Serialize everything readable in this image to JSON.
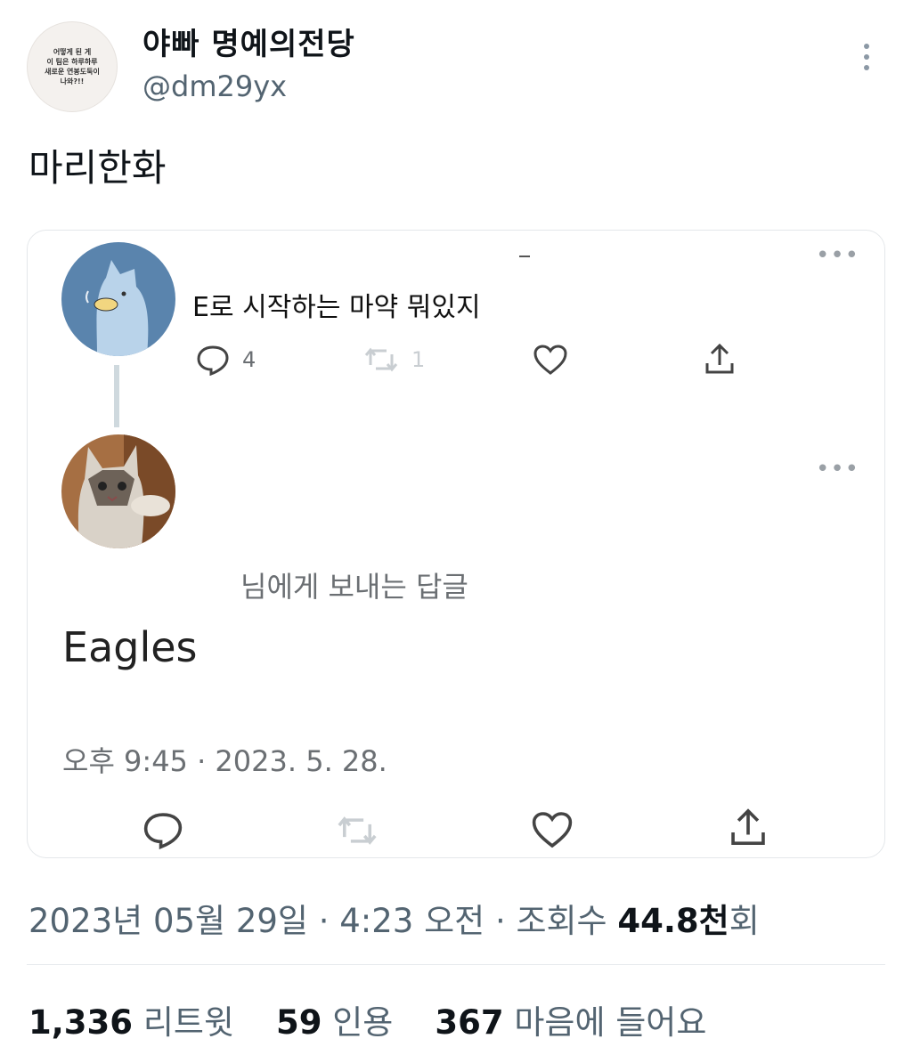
{
  "author": {
    "avatar_text": [
      "어떻게 된 게",
      "이 팀은 하루하루",
      "새로운 연봉도둑이",
      "나와?!!"
    ],
    "display_name": "야빠 명예의전당",
    "handle": "@dm29yx"
  },
  "tweet": {
    "text": "마리한화"
  },
  "quote": {
    "first": {
      "text": "E로 시작하는 마약 뭐있지",
      "reply_count": "4",
      "retweet_count": "1"
    },
    "second": {
      "reply_to": "님에게 보내는 답글",
      "text": "Eagles",
      "timestamp": "오후 9:45 · 2023. 5. 28."
    }
  },
  "meta": {
    "datetime": "2023년 05월 29일 · 4:23 오전 · 조회수 ",
    "views": "44.8천",
    "views_suffix": "회"
  },
  "stats": {
    "retweets": "1,336",
    "retweets_label": "리트윗",
    "quotes": "59",
    "quotes_label": "인용",
    "likes": "367",
    "likes_label": "마음에 들어요"
  },
  "icons": {
    "more": "more-dots-icon",
    "reply": "reply-icon",
    "retweet": "retweet-icon",
    "like": "heart-icon",
    "share": "share-icon"
  },
  "colors": {
    "secondary_text": "#536471",
    "divider": "#e6e9ec"
  }
}
